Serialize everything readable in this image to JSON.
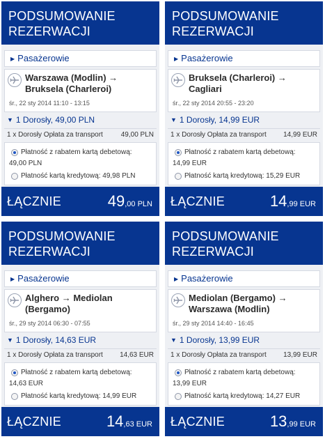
{
  "panels": [
    {
      "header": {
        "line1": "PODSUMOWANIE",
        "line2": "REZERWACJI"
      },
      "passengers_label": "Pasażerowie",
      "flight": {
        "route": "Warszawa (Modlin) → Bruksela (Charleroi)",
        "date": "śr., 22 sty 2014 11:10 - 13:15"
      },
      "pax": {
        "title": "1 Dorosły, 49,00 PLN",
        "fee_label": "1 x Dorosły Opłata za transport",
        "fee_amount": "49,00 PLN"
      },
      "payment": {
        "debit_label": "Płatność z rabatem kartą debetową:",
        "debit_amount": "49,00 PLN",
        "credit_label": "Płatność kartą kredytową: 49,98 PLN",
        "selected": "debit"
      },
      "total": {
        "label": "ŁĄCZNIE",
        "integer": "49",
        "decimal": ",00 PLN"
      }
    },
    {
      "header": {
        "line1": "PODSUMOWANIE",
        "line2": "REZERWACJI"
      },
      "passengers_label": "Pasażerowie",
      "flight": {
        "route": "Bruksela (Charleroi) → Cagliari",
        "date": "śr., 22 sty 2014 20:55 - 23:20"
      },
      "pax": {
        "title": "1 Dorosły, 14,99 EUR",
        "fee_label": "1 x Dorosły Opłata za transport",
        "fee_amount": "14,99 EUR"
      },
      "payment": {
        "debit_label": "Płatność z rabatem kartą debetową:",
        "debit_amount": "14,99 EUR",
        "credit_label": "Płatność kartą kredytową: 15,29 EUR",
        "selected": "debit"
      },
      "total": {
        "label": "ŁĄCZNIE",
        "integer": "14",
        "decimal": ",99 EUR"
      }
    },
    {
      "header": {
        "line1": "PODSUMOWANIE",
        "line2": "REZERWACJI"
      },
      "passengers_label": "Pasażerowie",
      "flight": {
        "route": "Alghero → Mediolan (Bergamo)",
        "date": "śr., 29 sty 2014 06:30 - 07:55"
      },
      "pax": {
        "title": "1 Dorosły, 14,63 EUR",
        "fee_label": "1 x Dorosły Opłata za transport",
        "fee_amount": "14,63 EUR"
      },
      "payment": {
        "debit_label": "Płatność z rabatem kartą debetową:",
        "debit_amount": "14,63 EUR",
        "credit_label": "Płatność kartą kredytową: 14,99 EUR",
        "selected": "debit"
      },
      "total": {
        "label": "ŁĄCZNIE",
        "integer": "14",
        "decimal": ",63 EUR"
      }
    },
    {
      "header": {
        "line1": "PODSUMOWANIE",
        "line2": "REZERWACJI"
      },
      "passengers_label": "Pasażerowie",
      "flight": {
        "route": "Mediolan (Bergamo) → Warszawa (Modlin)",
        "date": "śr., 29 sty 2014 14:40 - 16:45"
      },
      "pax": {
        "title": "1 Dorosły, 13,99 EUR",
        "fee_label": "1 x Dorosły Opłata za transport",
        "fee_amount": "13,99 EUR"
      },
      "payment": {
        "debit_label": "Płatność z rabatem kartą debetową:",
        "debit_amount": "13,99 EUR",
        "credit_label": "Płatność kartą kredytową: 14,27 EUR",
        "selected": "debit"
      },
      "total": {
        "label": "ŁĄCZNIE",
        "integer": "13",
        "decimal": ",99 EUR"
      }
    }
  ],
  "icons": {
    "passengers_arrow": "triangle-right-icon",
    "pax_toggle": "triangle-down-icon",
    "flight": "plane-icon"
  },
  "colors": {
    "brand_blue": "#073590",
    "panel_bg": "#eef0f4",
    "radio_selected": "#1d55c4"
  }
}
